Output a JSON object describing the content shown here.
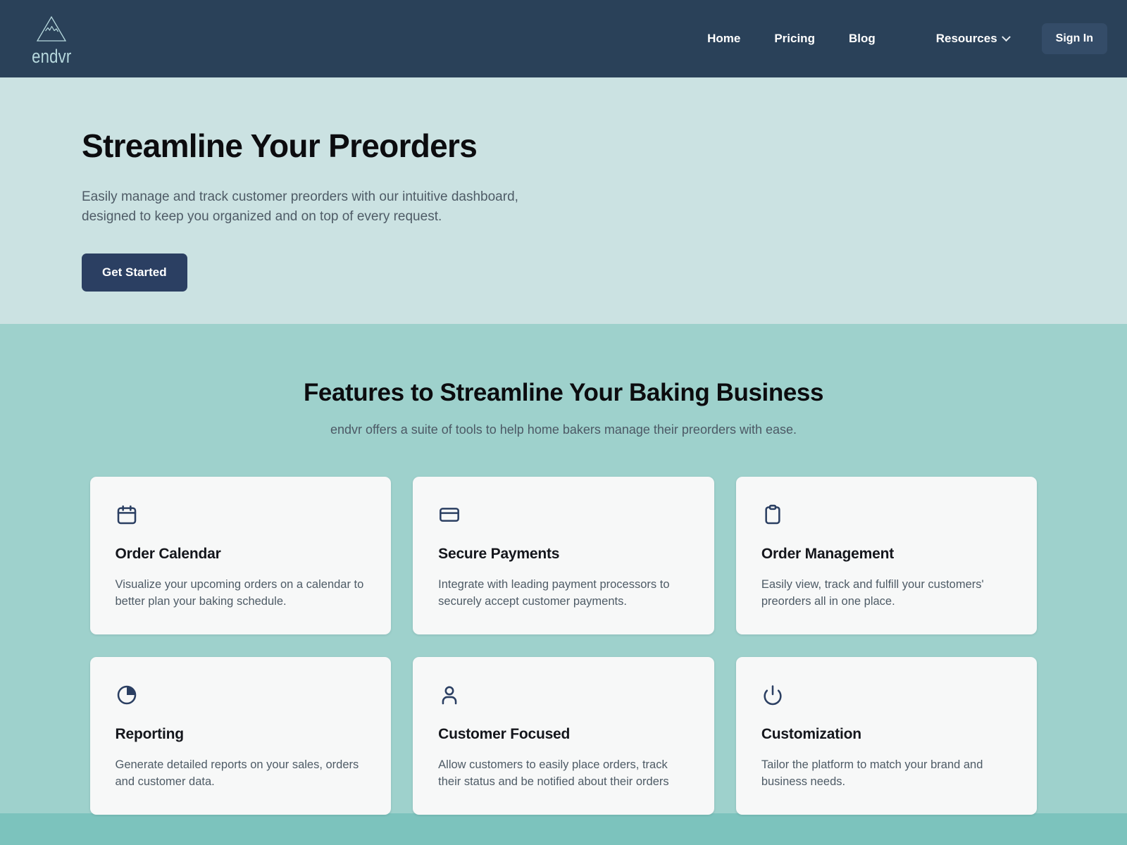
{
  "brand": {
    "name": "endvr",
    "logo_icon": "mountain-icon",
    "logo_color": "#b7d9de"
  },
  "navbar": {
    "background": "#2a4159",
    "links": [
      {
        "label": "Home",
        "name": "nav-link-home"
      },
      {
        "label": "Pricing",
        "name": "nav-link-pricing"
      },
      {
        "label": "Blog",
        "name": "nav-link-blog"
      }
    ],
    "resources": {
      "label": "Resources",
      "icon": "chevron-down-icon"
    },
    "signin_label": "Sign In"
  },
  "hero": {
    "background": "#cbe2e2",
    "title": "Streamline Your Preorders",
    "subtitle_line1": "Easily manage and track customer preorders with our intuitive dashboard,",
    "subtitle_line2": "designed to keep you organized and on top of every request.",
    "cta_label": "Get Started",
    "cta_color": "#2b3f62"
  },
  "features": {
    "background": "#9ed1cc",
    "title": "Features to Streamline Your Baking Business",
    "subtitle": "endvr offers a suite of tools to help home bakers manage their preorders with ease.",
    "card_background": "#f7f8f8",
    "icon_color": "#2b3f62",
    "cards": [
      {
        "icon": "calendar-icon",
        "title": "Order Calendar",
        "desc": "Visualize your upcoming orders on a calendar to better plan your baking schedule."
      },
      {
        "icon": "credit-card-icon",
        "title": "Secure Payments",
        "desc": "Integrate with leading payment processors to securely accept customer payments."
      },
      {
        "icon": "clipboard-icon",
        "title": "Order Management",
        "desc": "Easily view, track and fulfill your customers' preorders all in one place."
      },
      {
        "icon": "pie-chart-icon",
        "title": "Reporting",
        "desc": "Generate detailed reports on your sales, orders and customer data."
      },
      {
        "icon": "user-icon",
        "title": "Customer Focused",
        "desc": "Allow customers to easily place orders, track their status and be notified about their orders"
      },
      {
        "icon": "power-icon",
        "title": "Customization",
        "desc": "Tailor the platform to match your brand and business needs."
      }
    ]
  },
  "footer": {
    "background": "#7cc3bd"
  }
}
